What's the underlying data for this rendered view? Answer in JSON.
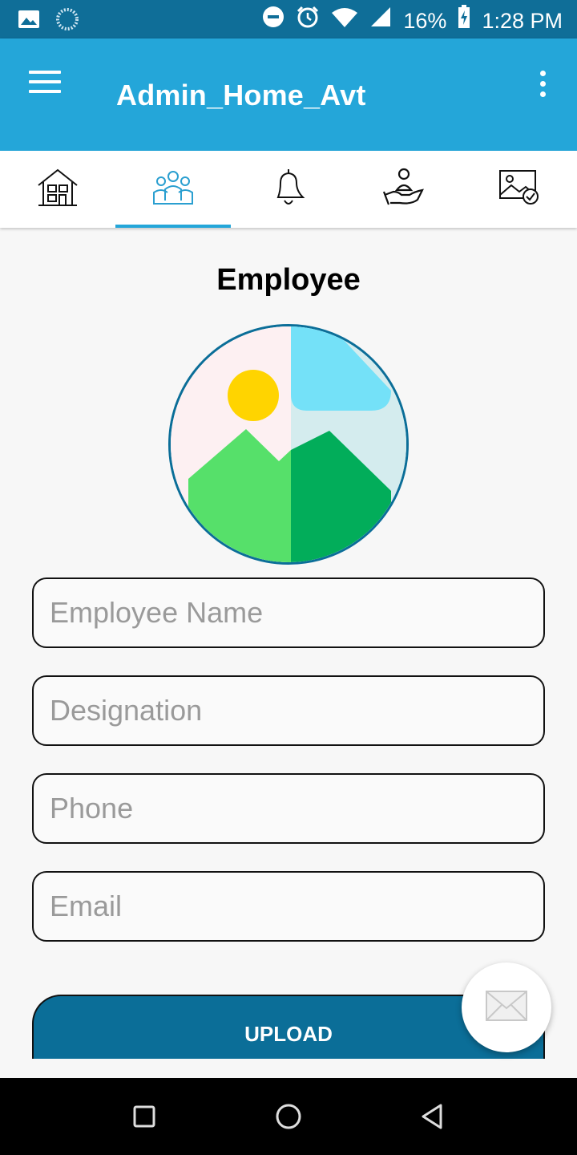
{
  "status_bar": {
    "battery": "16%",
    "time": "1:28 PM",
    "icons": [
      "image-icon",
      "sync-icon",
      "dnd-icon",
      "alarm-icon",
      "wifi-icon",
      "signal-icon",
      "battery-charging-icon"
    ]
  },
  "app_bar": {
    "title": "Admin_Home_Avt",
    "icons": [
      "menu-icon",
      "more-vert-icon"
    ]
  },
  "tabs": [
    {
      "icon": "home-icon",
      "active": false
    },
    {
      "icon": "team-icon",
      "active": true
    },
    {
      "icon": "bell-icon",
      "active": false
    },
    {
      "icon": "hand-person-icon",
      "active": false
    },
    {
      "icon": "gallery-check-icon",
      "active": false
    }
  ],
  "form": {
    "title": "Employee",
    "fields": [
      {
        "placeholder": "Employee Name",
        "value": ""
      },
      {
        "placeholder": "Designation",
        "value": ""
      },
      {
        "placeholder": "Phone",
        "value": ""
      },
      {
        "placeholder": "Email",
        "value": ""
      }
    ],
    "upload_label": "UPLOAD"
  },
  "fab": {
    "icon": "mail-icon"
  },
  "colors": {
    "status_bar": "#0f6e98",
    "app_bar": "#24a6d9",
    "accent": "#24a6d9",
    "button": "#0b6e98"
  }
}
